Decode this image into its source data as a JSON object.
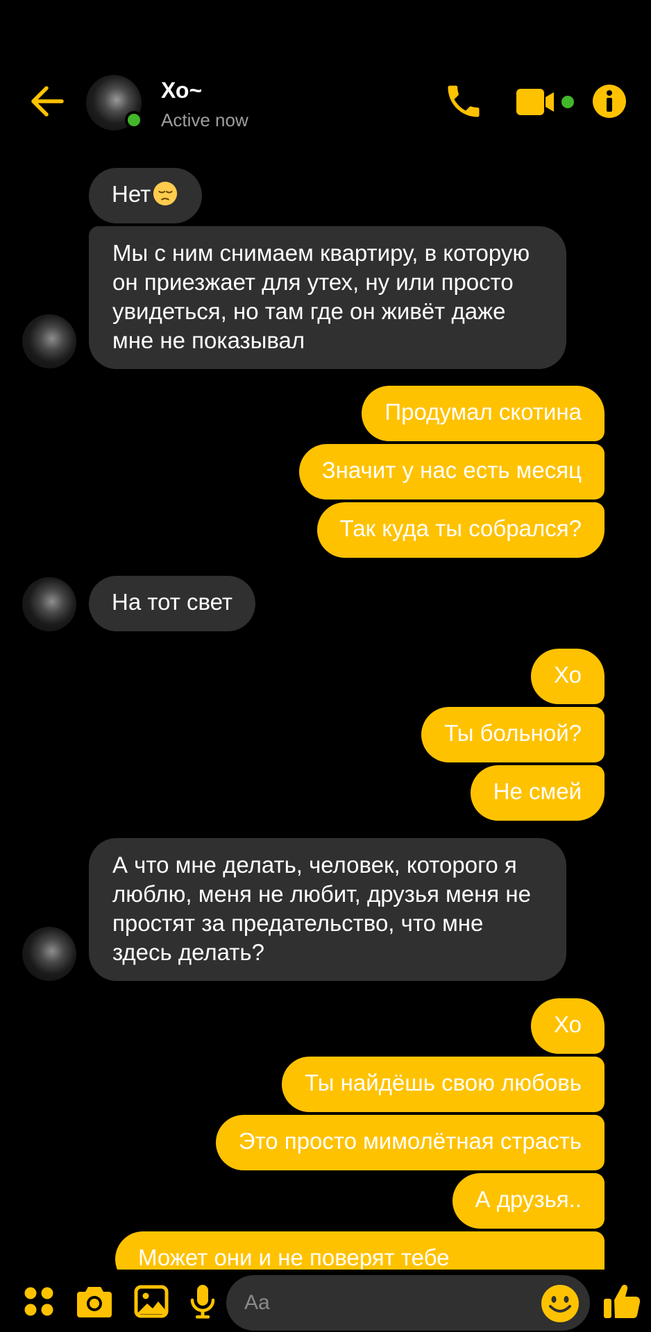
{
  "header": {
    "contact_name": "Хо~",
    "status": "Active now"
  },
  "colors": {
    "accent": "#ffc200",
    "received_bubble": "#303030",
    "online": "#42b72a",
    "background": "#000000"
  },
  "icons": [
    "back-arrow-icon",
    "phone-icon",
    "video-camera-icon",
    "info-icon",
    "apps-icon",
    "camera-icon",
    "image-icon",
    "microphone-icon",
    "smiley-icon",
    "thumbs-up-icon"
  ],
  "messages": [
    {
      "from": "them",
      "text": "Нет",
      "emoji": "pensive-face"
    },
    {
      "from": "them",
      "text": "Мы с ним снимаем квартиру, в которую он приезжает для утех, ну или просто увидеться, но там где он живёт даже мне не показывал"
    },
    {
      "from": "me",
      "text": "Продумал скотина"
    },
    {
      "from": "me",
      "text": "Значит у нас есть месяц"
    },
    {
      "from": "me",
      "text": "Так куда ты собрался?"
    },
    {
      "from": "them",
      "text": "На тот свет"
    },
    {
      "from": "me",
      "text": "Хо"
    },
    {
      "from": "me",
      "text": "Ты больной?"
    },
    {
      "from": "me",
      "text": "Не смей"
    },
    {
      "from": "them",
      "text": "А что мне делать, человек, которого я люблю, меня не любит, друзья меня не простят за предательство, что мне здесь делать?"
    },
    {
      "from": "me",
      "text": "Хо"
    },
    {
      "from": "me",
      "text": "Ты найдёшь свою любовь"
    },
    {
      "from": "me",
      "text": "Это просто мимолётная страсть"
    },
    {
      "from": "me",
      "text": "А друзья.."
    },
    {
      "from": "me",
      "text": "Может они и не поверят тебе"
    }
  ],
  "composer": {
    "placeholder": "Aa"
  }
}
